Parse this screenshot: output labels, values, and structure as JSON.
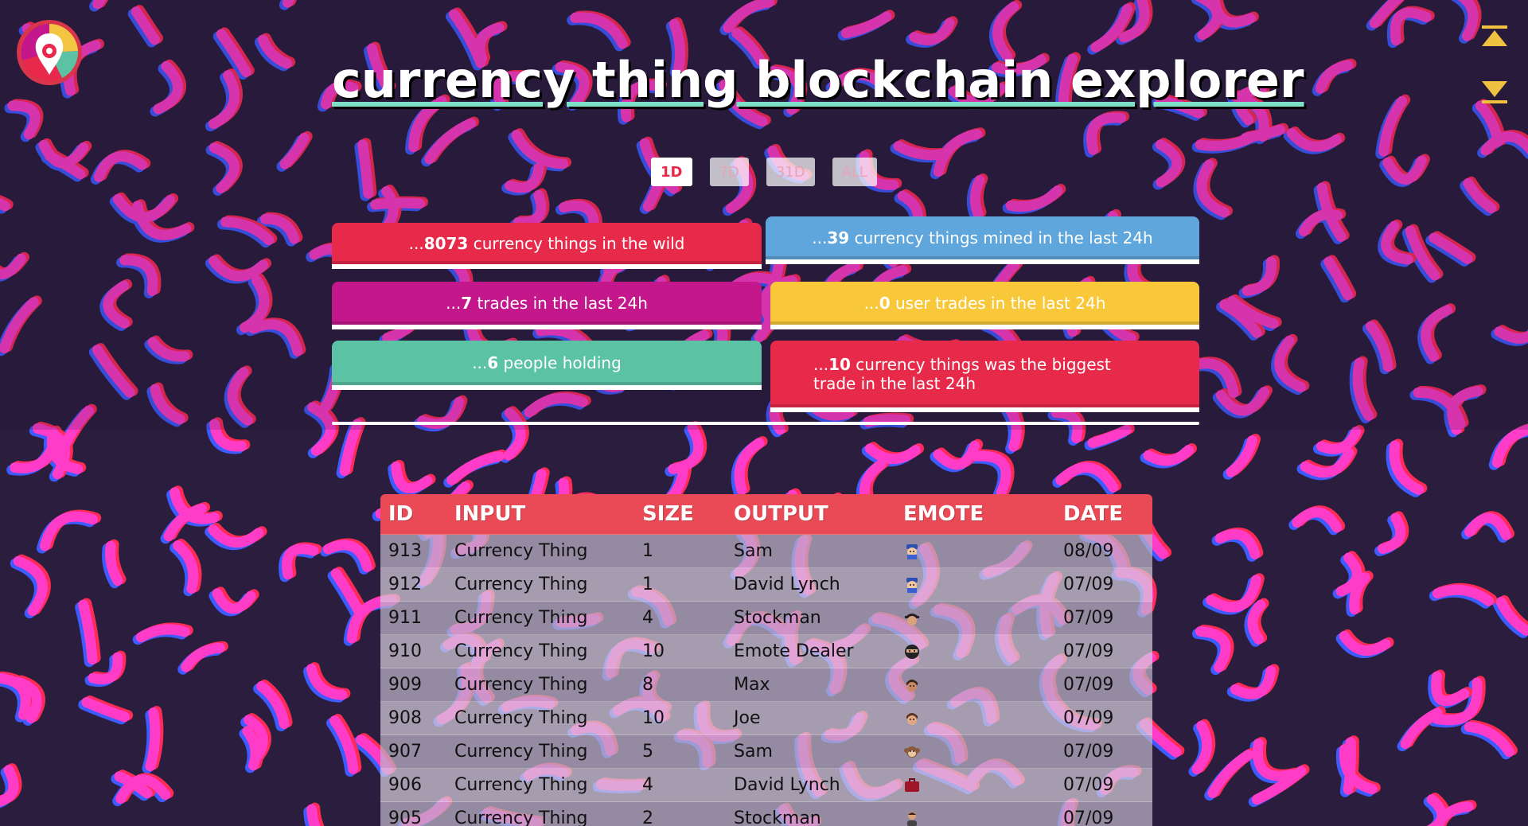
{
  "header": {
    "title": "currency thing blockchain explorer"
  },
  "icons": {
    "logo": "app-logo-icon",
    "scroll_top": "scroll-to-top-icon",
    "scroll_bottom": "scroll-to-bottom-icon"
  },
  "periods": [
    {
      "label": "1D",
      "active": true
    },
    {
      "label": "7D",
      "active": false
    },
    {
      "label": "31D",
      "active": false
    },
    {
      "label": "ALL",
      "active": false
    }
  ],
  "stats": {
    "in_wild": {
      "prefix": "...",
      "value": "8073",
      "text": " currency things in the wild"
    },
    "mined": {
      "prefix": "...",
      "value": "39",
      "text": " currency things mined in the last 24h"
    },
    "trades": {
      "prefix": "...",
      "value": "7",
      "text": " trades in the last 24h"
    },
    "user_trades": {
      "prefix": "...",
      "value": "0",
      "text": " user trades in the last 24h"
    },
    "holders": {
      "prefix": "...",
      "value": "6",
      "text": " people holding"
    },
    "biggest": {
      "prefix": "...",
      "value": "10",
      "text": " currency things was the biggest trade in the last 24h"
    }
  },
  "colors": {
    "red": "#e82a4a",
    "blue": "#5ea6dc",
    "magenta": "#c4178c",
    "yellow": "#f8c83a",
    "teal": "#5bc2a4",
    "table_header": "#e94a55",
    "background": "#2a1d3d",
    "squiggle_pink": "#ff3cc8",
    "squiggle_red": "#ff2a55",
    "squiggle_blue": "#3d5bff"
  },
  "table": {
    "columns": [
      "ID",
      "INPUT",
      "SIZE",
      "OUTPUT",
      "EMOTE",
      "DATE"
    ],
    "rows": [
      {
        "id": "913",
        "input": "Currency Thing",
        "size": "1",
        "output": "Sam",
        "emote": "police-emote",
        "date": "08/09"
      },
      {
        "id": "912",
        "input": "Currency Thing",
        "size": "1",
        "output": "David Lynch",
        "emote": "police-emote",
        "date": "07/09"
      },
      {
        "id": "911",
        "input": "Currency Thing",
        "size": "4",
        "output": "Stockman",
        "emote": "cap-head-emote",
        "date": "07/09"
      },
      {
        "id": "910",
        "input": "Currency Thing",
        "size": "10",
        "output": "Emote Dealer",
        "emote": "ninja-emote",
        "date": "07/09"
      },
      {
        "id": "909",
        "input": "Currency Thing",
        "size": "8",
        "output": "Max",
        "emote": "face-emote",
        "date": "07/09"
      },
      {
        "id": "908",
        "input": "Currency Thing",
        "size": "10",
        "output": "Joe",
        "emote": "face-emote",
        "date": "07/09"
      },
      {
        "id": "907",
        "input": "Currency Thing",
        "size": "5",
        "output": "Sam",
        "emote": "monkey-emote",
        "date": "07/09"
      },
      {
        "id": "906",
        "input": "Currency Thing",
        "size": "4",
        "output": "David Lynch",
        "emote": "briefcase-emote",
        "date": "07/09"
      },
      {
        "id": "905",
        "input": "Currency Thing",
        "size": "2",
        "output": "Stockman",
        "emote": "person-emote",
        "date": "07/09"
      }
    ]
  }
}
